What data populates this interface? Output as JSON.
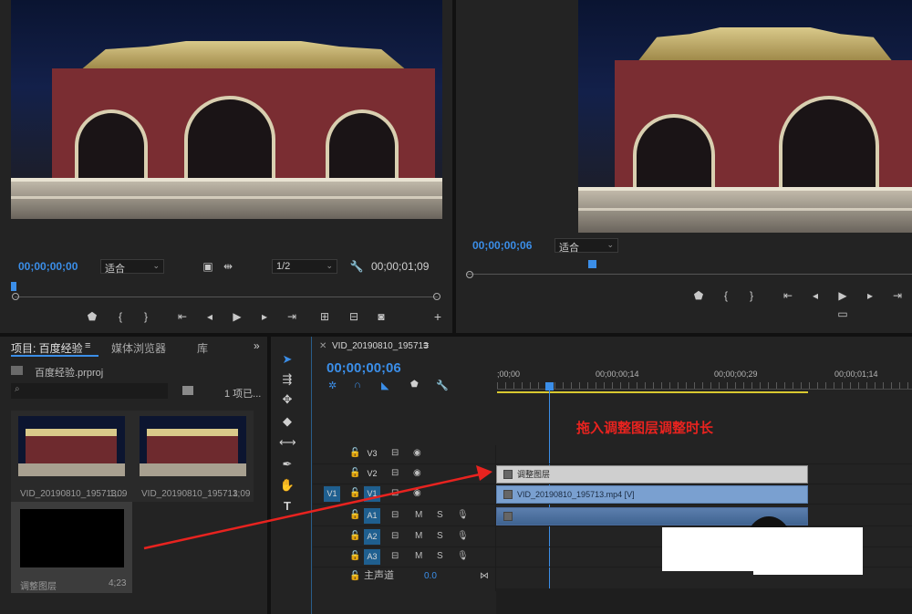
{
  "source_monitor": {
    "timecode": "00;00;00;00",
    "fit_label": "适合",
    "resolution_label": "1/2",
    "duration": "00;00;01;09"
  },
  "program_monitor": {
    "timecode": "00;00;00;06",
    "fit_label": "适合"
  },
  "project_panel": {
    "tabs": [
      "项目: 百度经验",
      "媒体浏览器",
      "库"
    ],
    "project_file": "百度经验.prproj",
    "item_count": "1 项已...",
    "items": [
      {
        "name": "VID_20190810_195713...",
        "duration": "1;09"
      },
      {
        "name": "VID_20190810_195713",
        "duration": "1;09"
      },
      {
        "name": "调整图层",
        "duration": "4;23"
      }
    ]
  },
  "timeline": {
    "sequence_name": "VID_20190810_195713",
    "timecode": "00;00;00;06",
    "ruler_labels": [
      ";00;00",
      "00;00;00;14",
      "00;00;00;29",
      "00;00;01;14"
    ],
    "tracks": {
      "v3": "V3",
      "v2": "V2",
      "v1": "V1",
      "v1_src": "V1",
      "a1": "A1",
      "a2": "A2",
      "a3": "A3",
      "m": "M",
      "s": "S",
      "master": "主声道",
      "master_value": "0.0"
    },
    "clips": {
      "adjustment": "调整图层",
      "video": "VID_20190810_195713.mp4 [V]"
    }
  },
  "annotation": {
    "text": "拖入调整图层调整时长",
    "color": "#e8231f"
  },
  "colors": {
    "accent": "#3b8ee8",
    "arrow": "#e8231f"
  }
}
